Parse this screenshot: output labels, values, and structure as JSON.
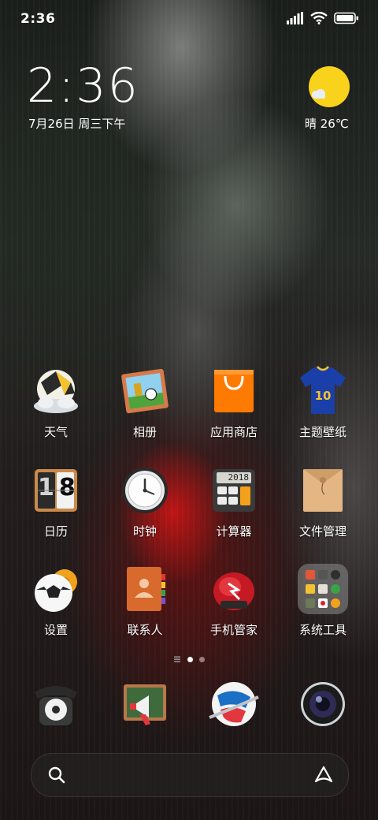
{
  "status_bar": {
    "time": "2:36",
    "icons": [
      "signal-icon",
      "wifi-icon",
      "battery-icon"
    ]
  },
  "clock_widget": {
    "time": "2:36",
    "date": "7月26日 周三下午"
  },
  "weather_widget": {
    "icon": "sun-cloud-icon",
    "text": "晴 26℃"
  },
  "app_grid": {
    "rows": [
      [
        {
          "label": "天气",
          "icon": "weather-icon"
        },
        {
          "label": "相册",
          "icon": "gallery-icon"
        },
        {
          "label": "应用商店",
          "icon": "app-store-icon"
        },
        {
          "label": "主题壁纸",
          "icon": "themes-icon"
        }
      ],
      [
        {
          "label": "日历",
          "icon": "calendar-icon",
          "number": "18"
        },
        {
          "label": "时钟",
          "icon": "clock-icon"
        },
        {
          "label": "计算器",
          "icon": "calculator-icon",
          "display": "2018"
        },
        {
          "label": "文件管理",
          "icon": "file-manager-icon"
        }
      ],
      [
        {
          "label": "设置",
          "icon": "settings-icon"
        },
        {
          "label": "联系人",
          "icon": "contacts-icon"
        },
        {
          "label": "手机管家",
          "icon": "security-icon"
        },
        {
          "label": "系统工具",
          "icon": "system-tools-folder-icon"
        }
      ]
    ]
  },
  "page_indicator": {
    "pages": 2,
    "current": 1
  },
  "dock": [
    {
      "icon": "phone-icon"
    },
    {
      "icon": "messages-icon"
    },
    {
      "icon": "browser-icon"
    },
    {
      "icon": "camera-icon"
    }
  ],
  "search_bar": {
    "left_icon": "search-icon",
    "right_icon": "assistant-icon"
  },
  "colors": {
    "weather_sun": "#f9d21b",
    "app_store_orange": "#ff7a00",
    "jersey_blue": "#1b3fa8"
  }
}
